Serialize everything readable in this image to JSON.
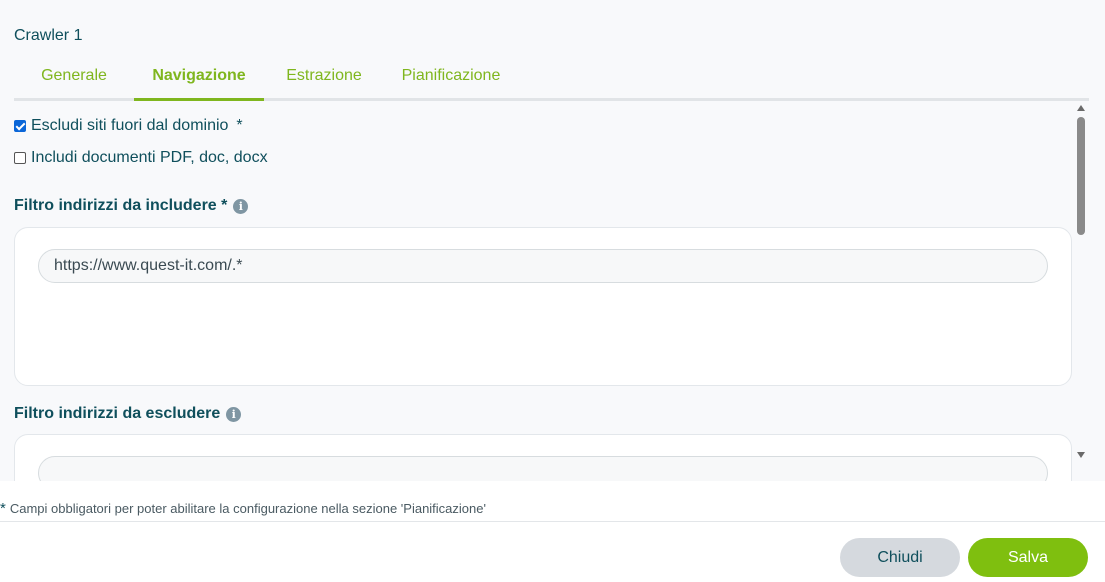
{
  "dialog": {
    "title": "Crawler 1"
  },
  "tabs": [
    {
      "label": "Generale",
      "active": false
    },
    {
      "label": "Navigazione",
      "active": true
    },
    {
      "label": "Estrazione",
      "active": false
    },
    {
      "label": "Pianificazione",
      "active": false
    }
  ],
  "options": {
    "exclude_external": {
      "label": "Escludi siti fuori dal dominio",
      "required_mark": "*",
      "checked": true
    },
    "include_docs": {
      "label": "Includi documenti PDF, doc, docx",
      "checked": false
    }
  },
  "include_filter": {
    "label": "Filtro indirizzi da includere *",
    "info_icon": "i",
    "values": [
      "https://www.quest-it.com/.*"
    ]
  },
  "exclude_filter": {
    "label": "Filtro indirizzi da escludere",
    "info_icon": "i",
    "values": [
      ""
    ]
  },
  "footnote": {
    "star": "*",
    "text": "Campi obbligatori per poter abilitare la configurazione nella sezione 'Pianificazione'"
  },
  "buttons": {
    "close": "Chiudi",
    "save": "Salva"
  },
  "colors": {
    "accent": "#7fb61e",
    "text": "#0f4f5c",
    "save_button": "#7fbf0f",
    "close_button": "#d5d9de"
  }
}
